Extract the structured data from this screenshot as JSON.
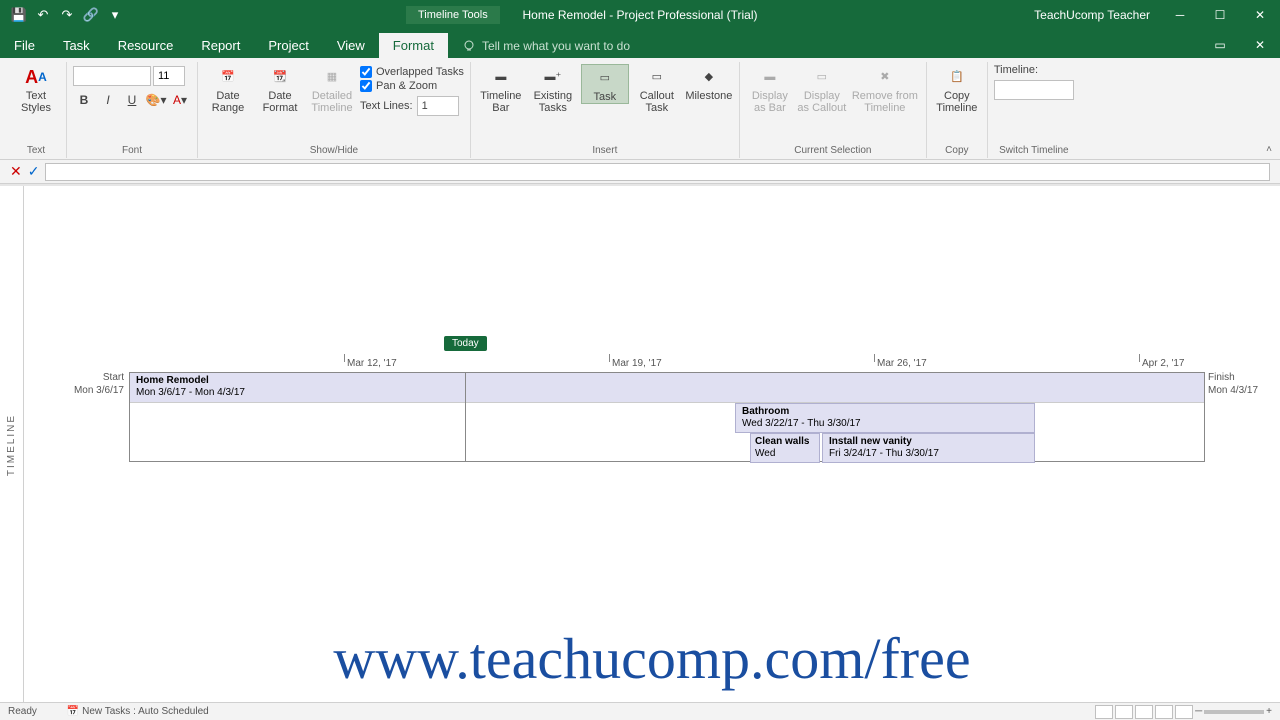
{
  "titlebar": {
    "tools": "Timeline Tools",
    "title": "Home Remodel  -  Project Professional (Trial)",
    "user": "TeachUcomp Teacher"
  },
  "menu": {
    "tabs": [
      "File",
      "Task",
      "Resource",
      "Report",
      "Project",
      "View",
      "Format"
    ],
    "active": "Format",
    "tellme": "Tell me what you want to do"
  },
  "ribbon": {
    "text_styles": "Text\nStyles",
    "text_group": "Text",
    "font": {
      "name": "",
      "size": "11",
      "group": "Font"
    },
    "date_range": "Date\nRange",
    "date_format": "Date\nFormat",
    "detailed": "Detailed\nTimeline",
    "overlapped": "Overlapped Tasks",
    "panzoom": "Pan & Zoom",
    "textlines_lbl": "Text Lines:",
    "textlines_val": "1",
    "showhide_group": "Show/Hide",
    "timeline_bar": "Timeline\nBar",
    "existing": "Existing\nTasks",
    "task": "Task",
    "callout": "Callout\nTask",
    "milestone": "Milestone",
    "insert_group": "Insert",
    "disp_bar": "Display\nas Bar",
    "disp_callout": "Display\nas Callout",
    "remove": "Remove from\nTimeline",
    "cursel_group": "Current Selection",
    "copy": "Copy\nTimeline",
    "copy_group": "Copy",
    "tl_lbl": "Timeline:",
    "switch_group": "Switch Timeline"
  },
  "timeline": {
    "side": "TIMELINE",
    "today": "Today",
    "dates": [
      "Mar 12, '17",
      "Mar 19, '17",
      "Mar 26, '17",
      "Apr 2, '17"
    ],
    "start_lbl": "Start",
    "start_date": "Mon 3/6/17",
    "finish_lbl": "Finish",
    "finish_date": "Mon 4/3/17",
    "project": {
      "name": "Home Remodel",
      "range": "Mon 3/6/17 - Mon 4/3/17"
    },
    "bathroom": {
      "name": "Bathroom",
      "range": "Wed 3/22/17 - Thu 3/30/17"
    },
    "clean": {
      "name": "Clean walls",
      "range": "Wed"
    },
    "vanity": {
      "name": "Install new vanity",
      "range": "Fri 3/24/17 - Thu 3/30/17"
    }
  },
  "watermark": "www.teachucomp.com/free",
  "status": {
    "ready": "Ready",
    "sched": "New Tasks : Auto Scheduled"
  }
}
